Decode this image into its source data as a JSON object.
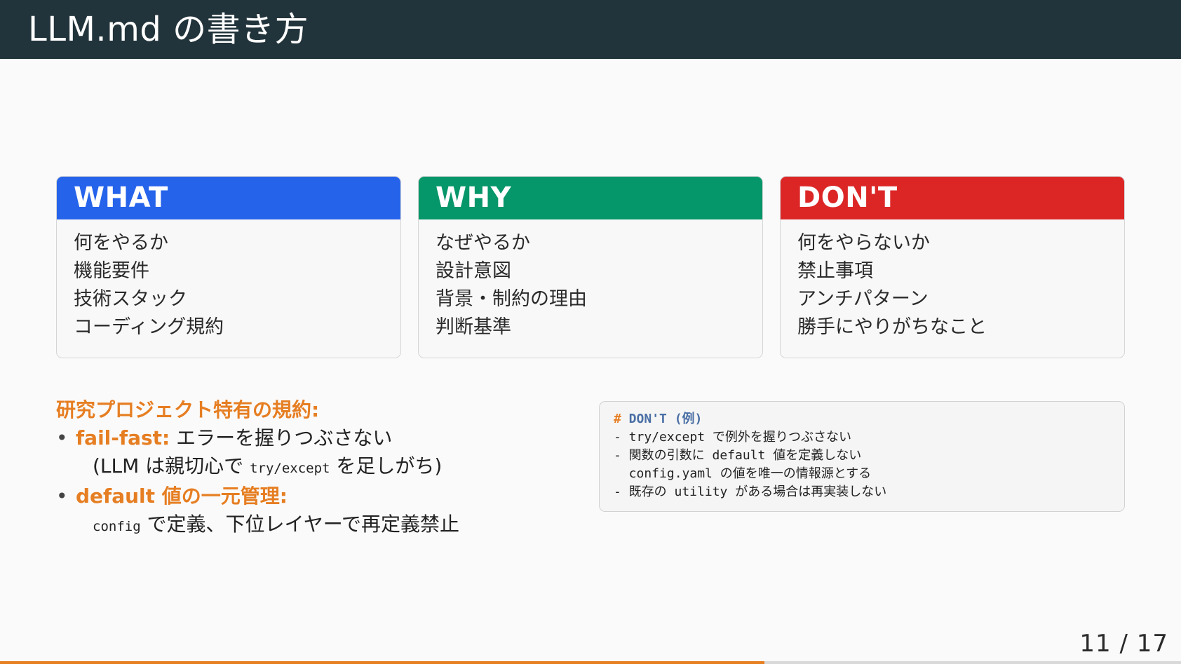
{
  "slide": {
    "title": "LLM.md の書き方",
    "page_number": "11 / 17",
    "progress_fraction": 0.647
  },
  "colors": {
    "what": "#2563eb",
    "why": "#059669",
    "dont": "#dc2626",
    "accent": "#e67e22",
    "header_bg": "#22343b"
  },
  "cards": [
    {
      "title": "WHAT",
      "items": [
        "何をやるか",
        "機能要件",
        "技術スタック",
        "コーディング規約"
      ]
    },
    {
      "title": "WHY",
      "items": [
        "なぜやるか",
        "設計意図",
        "背景・制約の理由",
        "判断基準"
      ]
    },
    {
      "title": "DON'T",
      "items": [
        "何をやらないか",
        "禁止事項",
        "アンチパターン",
        "勝手にやりがちなこと"
      ]
    }
  ],
  "rules": {
    "heading": "研究プロジェクト特有の規約:",
    "bullet_mark": "•",
    "item1": {
      "keyword": "fail-fast:",
      "text": " エラーを握りつぶさない",
      "sub_before": "(LLM は親切心で ",
      "sub_code": "try/except",
      "sub_after": " を足しがち)"
    },
    "item2": {
      "keyword": "default 値の一元管理:",
      "sub_code": "config",
      "sub_after": " で定義、下位レイヤーで再定義禁止"
    }
  },
  "code_block": {
    "hash": "#",
    "header": " DON'T (例)",
    "lines": [
      "- try/except で例外を握りつぶさない",
      "- 関数の引数に default 値を定義しない",
      "  config.yaml の値を唯一の情報源とする",
      "- 既存の utility がある場合は再実装しない"
    ]
  }
}
